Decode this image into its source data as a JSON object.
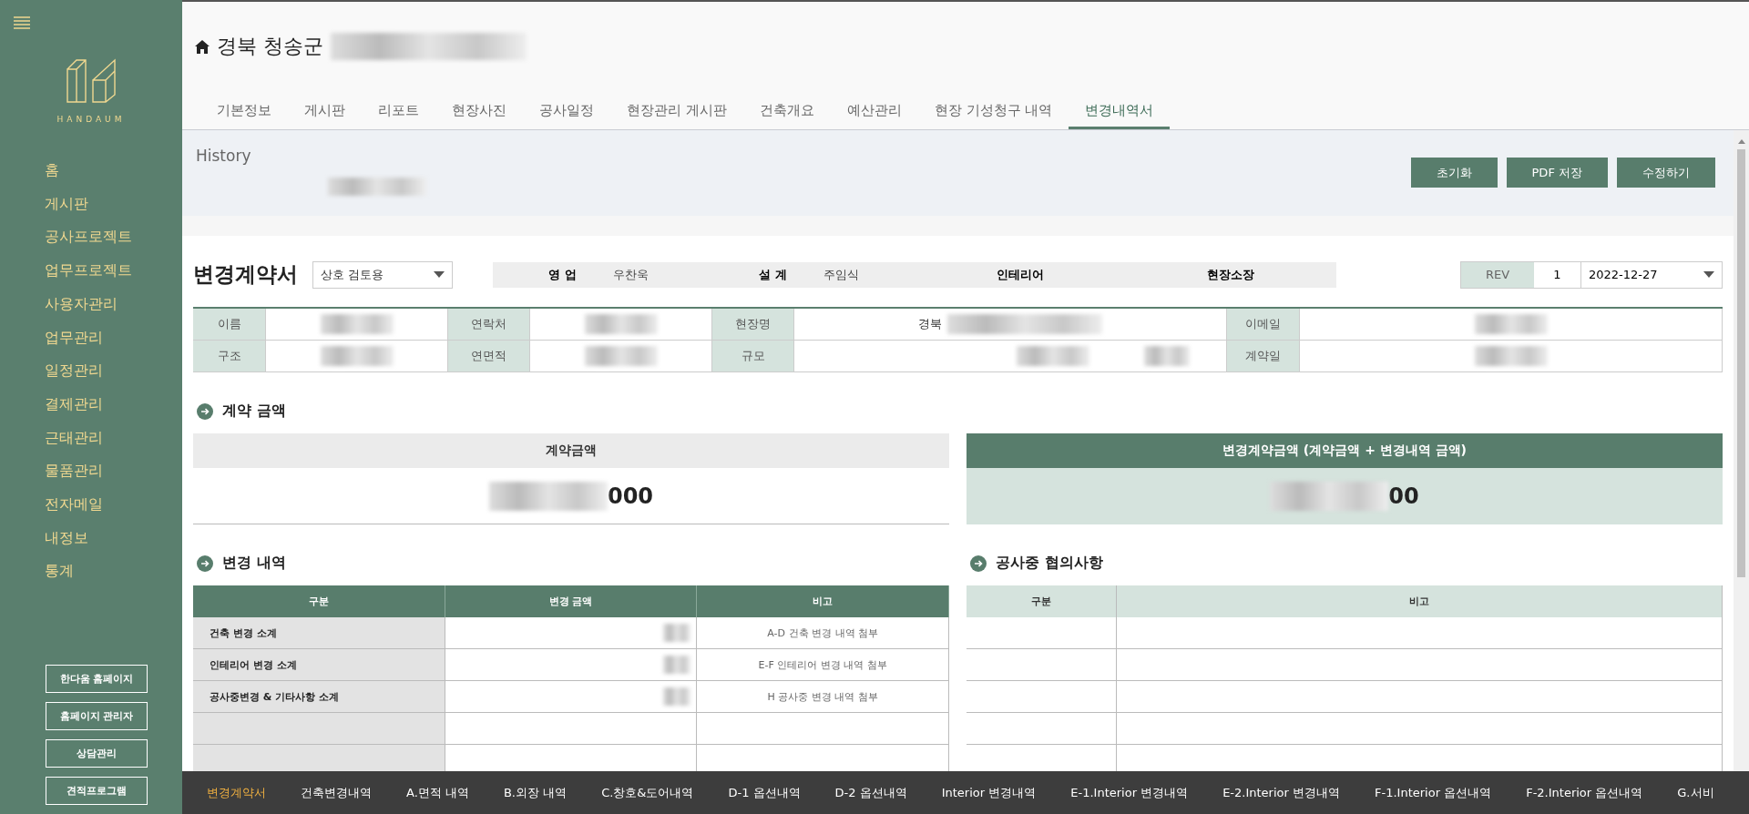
{
  "sidebar": {
    "menu": [
      "홈",
      "게시판",
      "공사프로젝트",
      "업무프로젝트",
      "사용자관리",
      "업무관리",
      "일정관리",
      "결제관리",
      "근태관리",
      "물품관리",
      "전자메일",
      "내정보",
      "통계"
    ],
    "logo_text": "HANDAUM",
    "links": [
      "한다움 홈페이지",
      "홈페이지 관리자",
      "상담관리",
      "견적프로그램"
    ]
  },
  "header": {
    "title": "경북 청송군"
  },
  "tabs": [
    {
      "label": "기본정보",
      "selected": false
    },
    {
      "label": "게시판",
      "selected": false
    },
    {
      "label": "리포트",
      "selected": false
    },
    {
      "label": "현장사진",
      "selected": false
    },
    {
      "label": "공사일정",
      "selected": false
    },
    {
      "label": "현장관리 게시판",
      "selected": false
    },
    {
      "label": "건축개요",
      "selected": false
    },
    {
      "label": "예산관리",
      "selected": false
    },
    {
      "label": "현장 기성청구 내역",
      "selected": false
    },
    {
      "label": "변경내역서",
      "selected": true
    }
  ],
  "history": {
    "title": "History",
    "buttons": [
      "초기화",
      "PDF 저장",
      "수정하기"
    ]
  },
  "contract": {
    "title": "변경계약서",
    "select": "상호 검토용",
    "roles": [
      {
        "label": "영 업",
        "name": "우찬욱"
      },
      {
        "label": "설 계",
        "name": "주임식"
      },
      {
        "label": "인테리어"
      },
      {
        "label": "현장소장"
      }
    ],
    "rev": {
      "label": "REV",
      "value": "1",
      "date": "2022-12-27"
    }
  },
  "info_rows": [
    [
      {
        "kind": "label",
        "text": "이름"
      },
      {
        "kind": "redacted"
      },
      {
        "kind": "label",
        "text": "연락처"
      },
      {
        "kind": "redacted"
      },
      {
        "kind": "label",
        "text": "현장명"
      },
      {
        "kind": "value",
        "text": "경북"
      },
      {
        "kind": "label",
        "text": "이메일"
      },
      {
        "kind": "redacted"
      }
    ],
    [
      {
        "kind": "label",
        "text": "구조"
      },
      {
        "kind": "redacted"
      },
      {
        "kind": "label",
        "text": "연면적"
      },
      {
        "kind": "redacted"
      },
      {
        "kind": "label",
        "text": "규모"
      },
      {
        "kind": "split"
      },
      {
        "kind": "label",
        "text": "계약일"
      },
      {
        "kind": "redacted"
      }
    ]
  ],
  "amount": {
    "title": "계약 금액",
    "contract": {
      "header": "계약금액",
      "value": "000"
    },
    "changed": {
      "header": "변경계약금액 (계약금액 + 변경내역 금액)",
      "value": "00"
    }
  },
  "changes": {
    "title": "변경 내역",
    "columns": [
      "구분",
      "변경 금액",
      "비고"
    ],
    "rows": [
      {
        "label": "건축 변경 소계",
        "note": "A-D 건축 변경 내역 첨부"
      },
      {
        "label": "인테리어 변경 소계",
        "note": "E-F 인테리어 변경 내역 첨부"
      },
      {
        "label": "공사중변경 & 기타사항 소계",
        "note": "H 공사중 변경 내역 첨부"
      }
    ]
  },
  "consultation": {
    "title": "공사중 협의사항",
    "columns": [
      "구분",
      "비고"
    ]
  },
  "bottom_tabs": [
    {
      "label": "변경계약서",
      "selected": true
    },
    {
      "label": "건축변경내역",
      "selected": false
    },
    {
      "label": "A.면적 내역",
      "selected": false
    },
    {
      "label": "B.외장 내역",
      "selected": false
    },
    {
      "label": "C.창호&도어내역",
      "selected": false
    },
    {
      "label": "D-1 옵션내역",
      "selected": false
    },
    {
      "label": "D-2 옵션내역",
      "selected": false
    },
    {
      "label": "Interior 변경내역",
      "selected": false
    },
    {
      "label": "E-1.Interior 변경내역",
      "selected": false
    },
    {
      "label": "E-2.Interior 변경내역",
      "selected": false
    },
    {
      "label": "F-1.Interior 옵션내역",
      "selected": false
    },
    {
      "label": "F-2.Interior 옵션내역",
      "selected": false
    },
    {
      "label": "G.서비",
      "selected": false
    }
  ]
}
